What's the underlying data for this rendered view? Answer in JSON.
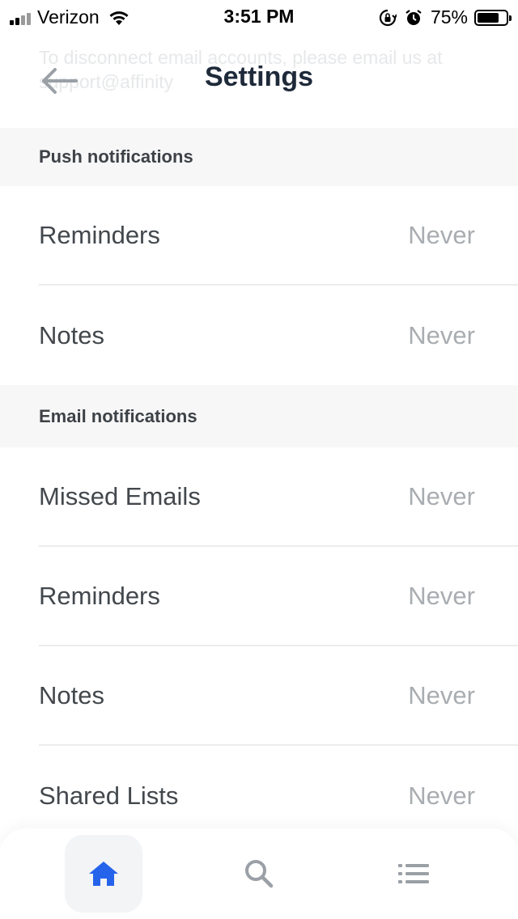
{
  "status_bar": {
    "carrier": "Verizon",
    "time": "3:51 PM",
    "battery": "75%",
    "battery_level": 0.75,
    "icons": [
      "signal-icon",
      "wifi-icon",
      "rotation-lock-icon",
      "alarm-icon",
      "battery-icon"
    ]
  },
  "header": {
    "title": "Settings",
    "back_icon": "arrow-left-icon",
    "ghost_text_line1": "To disconnect email accounts, please email us at",
    "ghost_text_line2": "support@affinity"
  },
  "sections": [
    {
      "title": "Push notifications",
      "rows": [
        {
          "label": "Reminders",
          "value": "Never"
        },
        {
          "label": "Notes",
          "value": "Never"
        }
      ]
    },
    {
      "title": "Email notifications",
      "rows": [
        {
          "label": "Missed Emails",
          "value": "Never"
        },
        {
          "label": "Reminders",
          "value": "Never"
        },
        {
          "label": "Notes",
          "value": "Never"
        },
        {
          "label": "Shared Lists",
          "value": "Never"
        }
      ]
    }
  ],
  "tab_bar": {
    "tabs": [
      {
        "icon": "home-icon",
        "active": true
      },
      {
        "icon": "search-icon",
        "active": false
      },
      {
        "icon": "list-icon",
        "active": false
      }
    ]
  },
  "colors": {
    "accent": "#2563eb",
    "title": "#1e2a3a",
    "section_bg": "#f7f7f8",
    "value_text": "#a9adb1",
    "icon_gray": "#9aa0a6"
  }
}
